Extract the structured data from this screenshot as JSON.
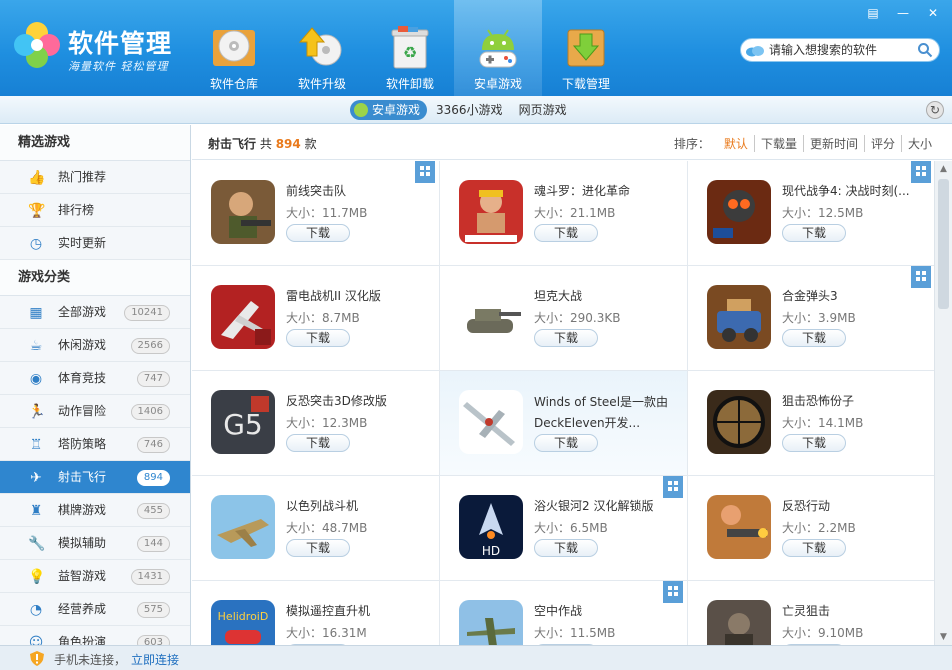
{
  "app": {
    "title": "软件管理",
    "slogan": "海量软件 轻松管理"
  },
  "nav": [
    {
      "label": "软件仓库",
      "icon": "disc-icon"
    },
    {
      "label": "软件升级",
      "icon": "upgrade-arrow-icon"
    },
    {
      "label": "软件卸载",
      "icon": "recycle-bin-icon"
    },
    {
      "label": "安卓游戏",
      "icon": "android-gamepad-icon",
      "active": true
    },
    {
      "label": "下载管理",
      "icon": "download-box-icon"
    }
  ],
  "search": {
    "placeholder": "请输入想搜索的软件"
  },
  "subnav": {
    "tabs": [
      "安卓游戏",
      "3366小游戏",
      "网页游戏"
    ],
    "active": 0
  },
  "sidebar": {
    "featured_title": "精选游戏",
    "featured": [
      {
        "label": "热门推荐",
        "icon": "thumbs-up-icon"
      },
      {
        "label": "排行榜",
        "icon": "trophy-icon"
      },
      {
        "label": "实时更新",
        "icon": "clock-icon"
      }
    ],
    "category_title": "游戏分类",
    "categories": [
      {
        "label": "全部游戏",
        "count": "10241",
        "icon": "grid-icon"
      },
      {
        "label": "休闲游戏",
        "count": "2566",
        "icon": "coffee-cup-icon"
      },
      {
        "label": "体育竞技",
        "count": "747",
        "icon": "ball-icon"
      },
      {
        "label": "动作冒险",
        "count": "1406",
        "icon": "running-man-icon"
      },
      {
        "label": "塔防策略",
        "count": "746",
        "icon": "tower-icon"
      },
      {
        "label": "射击飞行",
        "count": "894",
        "icon": "plane-icon",
        "active": true
      },
      {
        "label": "棋牌游戏",
        "count": "455",
        "icon": "chess-rook-icon"
      },
      {
        "label": "模拟辅助",
        "count": "144",
        "icon": "wrench-icon"
      },
      {
        "label": "益智游戏",
        "count": "1431",
        "icon": "bulb-icon"
      },
      {
        "label": "经营养成",
        "count": "575",
        "icon": "pie-chart-icon"
      },
      {
        "label": "角色扮演",
        "count": "603",
        "icon": "mask-icon"
      }
    ]
  },
  "content": {
    "category": "射击飞行",
    "total_prefix": "共",
    "total": "894",
    "total_suffix": "款",
    "sort_label": "排序：",
    "sort_options": [
      "默认",
      "下载量",
      "更新时间",
      "评分",
      "大小"
    ],
    "sort_active": 0
  },
  "size_prefix": "大小：",
  "download_label": "下载",
  "apps": [
    {
      "name": "前线突击队",
      "size": "11.7MB",
      "badge": true,
      "icon": "front-commando-icon"
    },
    {
      "name": "魂斗罗：进化革命",
      "size": "21.1MB",
      "badge": false,
      "icon": "contra-icon"
    },
    {
      "name": "现代战争4: 决战时刻(...",
      "size": "12.5MB",
      "badge": true,
      "icon": "modern-combat-icon"
    },
    {
      "name": "雷电战机II 汉化版",
      "size": "8.7MB",
      "badge": false,
      "icon": "jet-fighter-icon"
    },
    {
      "name": "坦克大战",
      "size": "290.3KB",
      "badge": false,
      "icon": "tank-icon"
    },
    {
      "name": "合金弹头3",
      "size": "3.9MB",
      "badge": true,
      "icon": "metal-slug-icon"
    },
    {
      "name": "反恐突击3D修改版",
      "size": "12.3MB",
      "badge": false,
      "icon": "gs-logo-icon"
    },
    {
      "name": "Winds of Steel是一款由DeckEleven开发...",
      "size": "",
      "badge": false,
      "icon": "warplane-icon",
      "highlight": true,
      "description_only": true
    },
    {
      "name": "狙击恐怖份子",
      "size": "14.1MB",
      "badge": false,
      "icon": "sniper-scope-icon"
    },
    {
      "name": "以色列战斗机",
      "size": "48.7MB",
      "badge": false,
      "icon": "fighter-jet-icon"
    },
    {
      "name": "浴火银河2 汉化解锁版",
      "size": "6.5MB",
      "badge": true,
      "icon": "galaxy-on-fire-icon"
    },
    {
      "name": "反恐行动",
      "size": "2.2MB",
      "badge": false,
      "icon": "soldier-gun-icon"
    },
    {
      "name": "模拟遥控直升机",
      "size": "16.31M",
      "badge": false,
      "icon": "helidroid-icon"
    },
    {
      "name": "空中作战",
      "size": "11.5MB",
      "badge": true,
      "icon": "air-combat-icon"
    },
    {
      "name": "亡灵狙击",
      "size": "9.10MB",
      "badge": false,
      "icon": "dead-sniper-icon"
    }
  ],
  "footer": {
    "status": "手机未连接，",
    "connect": "立即连接"
  },
  "colors": {
    "header_blue": "#1f8fe0",
    "active_blue": "#2f86cf",
    "accent_orange": "#e97a1c",
    "link_blue": "#1f6fbf"
  }
}
